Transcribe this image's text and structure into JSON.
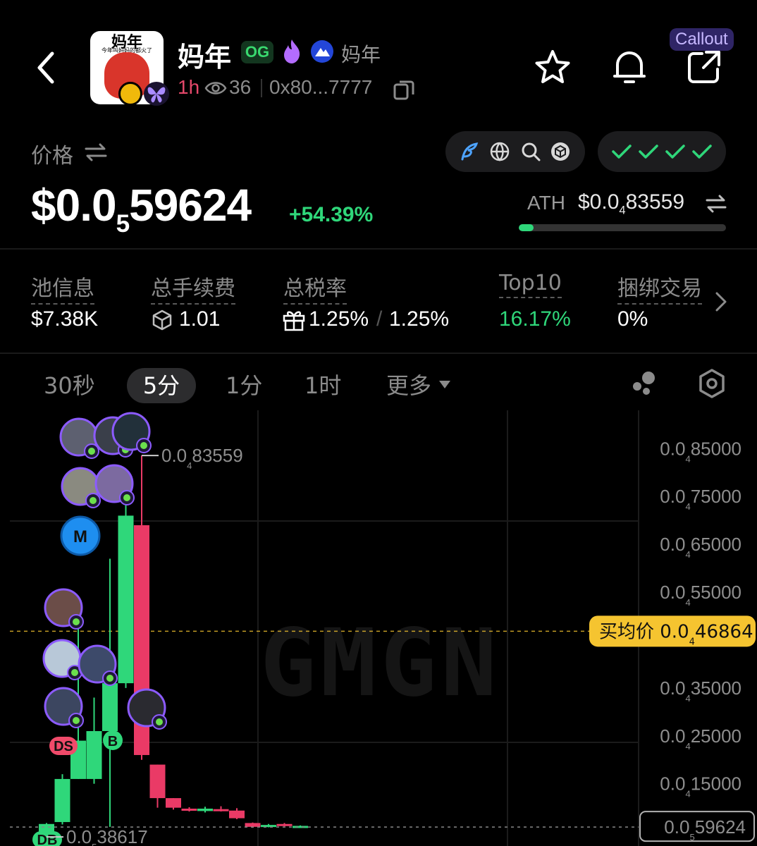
{
  "header": {
    "token_name": "妈年",
    "og_badge": "OG",
    "token_alias": "妈年",
    "age": "1h",
    "watch_count": "36",
    "address": "0x80...7777",
    "callout_label": "Callout",
    "logo": {
      "title": "妈年",
      "subtitle": "今年叫妈妈的都火了"
    }
  },
  "price": {
    "label": "价格",
    "prefix": "$0.0",
    "zeros": "5",
    "digits": "59624",
    "change": "+54.39%",
    "ath_label": "ATH",
    "ath_prefix": "$0.0",
    "ath_zeros": "4",
    "ath_digits": "83559",
    "ath_progress_pct": 7
  },
  "stats": {
    "pool_label": "池信息",
    "pool_value": "$7.38K",
    "fees_label": "总手续费",
    "fees_value": "1.01",
    "tax_label": "总税率",
    "tax_buy": "1.25%",
    "tax_sell": "1.25%",
    "top10_label": "Top10",
    "top10_value": "16.17%",
    "bundle_label": "捆绑交易",
    "bundle_value": "0%"
  },
  "timeframes": {
    "tab_30s": "30秒",
    "tab_5m": "5分",
    "tab_1m": "1分",
    "tab_1h": "1时",
    "tab_more": "更多",
    "selected": "5分"
  },
  "colors": {
    "up": "#2fd77a",
    "down": "#ea3a66",
    "accent_purple": "#8c5bff",
    "avg_buy": "#f5c430"
  },
  "icons": [
    "back-icon",
    "fire-icon",
    "mountain-icon",
    "eye-icon",
    "copy-icon",
    "star-icon",
    "bell-icon",
    "share-icon",
    "swap-icon",
    "feather-icon",
    "globe-icon",
    "search-icon",
    "cube-icon",
    "check-icon",
    "gift-icon",
    "chevron-right-icon",
    "dots-icon",
    "settings-icon"
  ],
  "chart_data": {
    "type": "candlestick",
    "watermark": "GMGN",
    "y_axis": [
      {
        "prefix": "0.0",
        "sub": "4",
        "digits": "85000",
        "value": 8.5e-06
      },
      {
        "prefix": "0.0",
        "sub": "4",
        "digits": "75000",
        "value": 7.5e-06
      },
      {
        "prefix": "0.0",
        "sub": "4",
        "digits": "65000",
        "value": 6.5e-06
      },
      {
        "prefix": "0.0",
        "sub": "4",
        "digits": "55000",
        "value": 5.5e-06
      },
      {
        "prefix": "0.0",
        "sub": "4",
        "digits": "35000",
        "value": 3.5e-06
      },
      {
        "prefix": "0.0",
        "sub": "4",
        "digits": "25000",
        "value": 2.5e-06
      },
      {
        "prefix": "0.0",
        "sub": "4",
        "digits": "15000",
        "value": 1.5e-06
      }
    ],
    "ylim": [
      2e-07,
      9.3e-06
    ],
    "avg_buy": {
      "label": "买均价",
      "prefix": "0.0",
      "sub": "4",
      "digits": "46864",
      "value": 4.6864e-06
    },
    "current": {
      "prefix": "0.0",
      "sub": "5",
      "digits": "59624",
      "value": 5.9624e-07
    },
    "high_label": {
      "prefix": "0.0",
      "sub": "4",
      "digits": "83559"
    },
    "low_label": {
      "prefix": "0.0",
      "sub": "5",
      "digits": "38617"
    },
    "candles": [
      {
        "o": 4.3e-07,
        "c": 6.6e-07,
        "h": 6.8e-07,
        "l": 3.9e-07
      },
      {
        "o": 7e-07,
        "c": 1.6e-06,
        "h": 1.7e-06,
        "l": 6.5e-07
      },
      {
        "o": 1.6e-06,
        "c": 2.4e-06,
        "h": 5.2e-06,
        "l": 1.6e-06
      },
      {
        "o": 1.6e-06,
        "c": 2.6e-06,
        "h": 3.3e-06,
        "l": 1.5e-06
      },
      {
        "o": 2.6e-06,
        "c": 3.6e-06,
        "h": 6.2e-06,
        "l": 6e-07
      },
      {
        "o": 3.6e-06,
        "c": 7.1e-06,
        "h": 7.4e-06,
        "l": 3.5e-06
      },
      {
        "o": 6.9e-06,
        "c": 2.1e-06,
        "h": 8.3559e-06,
        "l": 2e-06
      },
      {
        "o": 1.9e-06,
        "c": 1.2e-06,
        "h": 1.9e-06,
        "l": 1e-06
      },
      {
        "o": 1.2e-06,
        "c": 1e-06,
        "h": 1.2e-06,
        "l": 9.6e-07
      },
      {
        "o": 9.8e-07,
        "c": 9.4e-07,
        "h": 1.01e-06,
        "l": 9.2e-07
      },
      {
        "o": 9.3e-07,
        "c": 9.8e-07,
        "h": 1.02e-06,
        "l": 9e-07
      },
      {
        "o": 9.7e-07,
        "c": 9.4e-07,
        "h": 1.03e-06,
        "l": 9.2e-07
      },
      {
        "o": 9.4e-07,
        "c": 7.8e-07,
        "h": 9.9e-07,
        "l": 7.6e-07
      },
      {
        "o": 6.8e-07,
        "c": 6e-07,
        "h": 6.9e-07,
        "l": 5.8e-07
      },
      {
        "o": 6e-07,
        "c": 6.4e-07,
        "h": 6.6e-07,
        "l": 5.9e-07
      },
      {
        "o": 6.6e-07,
        "c": 6.3e-07,
        "h": 6.8e-07,
        "l": 6.1e-07
      },
      {
        "o": 6.1e-07,
        "c": 6.2e-07,
        "h": 6.3e-07,
        "l": 6e-07
      }
    ],
    "markers": [
      {
        "label": "M",
        "candle": 2
      },
      {
        "label": "DS",
        "candle": 0
      },
      {
        "label": "B",
        "candle": 4
      },
      {
        "label": "DB",
        "candle": 0
      }
    ]
  }
}
